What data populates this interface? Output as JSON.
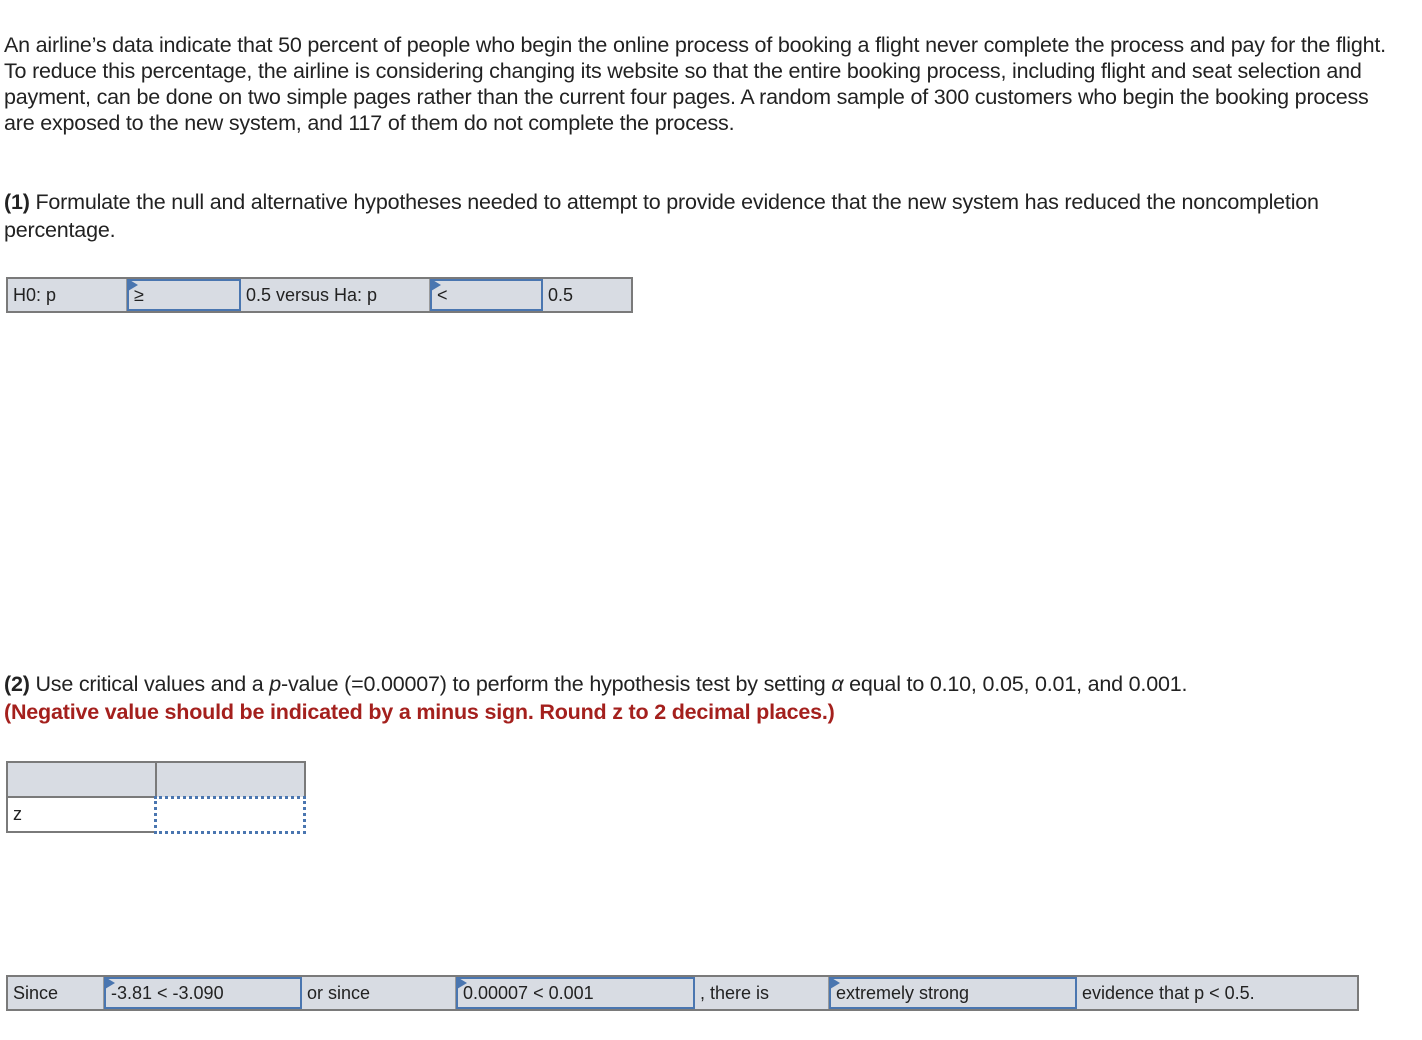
{
  "intro": "An airline’s data indicate that 50 percent of people who begin the online process of booking a flight never complete the process and pay for the flight. To reduce this percentage, the airline is considering changing its website so that the entire booking process, including flight and seat selection and payment, can be done on two simple pages rather than the current four pages. A random sample of 300 customers who begin the booking process are exposed to the new system, and 117 of them do not complete the process.",
  "q1": {
    "number": "(1)",
    "text": " Formulate the null and alternative hypotheses needed to attempt to provide evidence that the new system has reduced the noncompletion percentage."
  },
  "hypotheses": {
    "h0_label": "H0: p",
    "h0_operator": "≥",
    "middle_label": "0.5 versus Ha: p",
    "ha_operator": "<",
    "value": "0.5"
  },
  "q2": {
    "number": "(2)",
    "text_before_p": " Use critical values and a ",
    "p_italic": "p",
    "text_after_p": "-value (=0.00007) to perform the hypothesis test by setting ",
    "alpha": "α",
    "text_end": " equal to 0.10, 0.05, 0.01, and 0.001.",
    "instruction": "(Negative value should be indicated by a minus sign. Round z to 2 decimal places.)"
  },
  "z_table": {
    "header": [
      "",
      ""
    ],
    "row_label": "z",
    "z_value": ""
  },
  "conclusion": {
    "since_label": "Since",
    "critical_comparison": "-3.81 < -3.090",
    "or_since_label": "or since",
    "pvalue_comparison": "0.00007 < 0.001",
    "there_is_label": ", there is",
    "evidence_strength": "extremely strong",
    "evidence_label": "evidence that p < 0.5."
  }
}
